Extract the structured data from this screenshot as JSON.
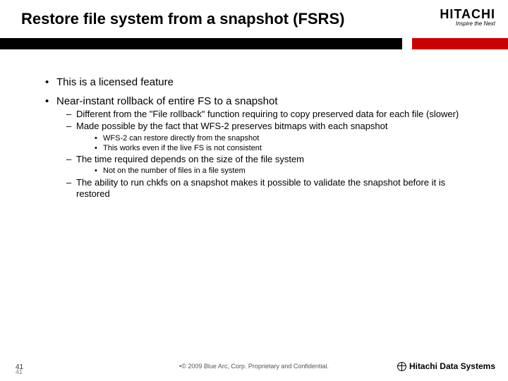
{
  "title": "Restore file system from a snapshot (FSRS)",
  "brand": {
    "name": "HITACHI",
    "tagline": "Inspire the Next",
    "footer_brand": "Hitachi Data Systems"
  },
  "bullets": {
    "b1": "This is a licensed feature",
    "b2": "Near-instant rollback of entire FS to a snapshot",
    "b2_sub": {
      "s1": "Different from the \"File rollback\" function requiring to copy preserved data for each file (slower)",
      "s2": "Made possible by the fact that WFS-2 preserves bitmaps with each snapshot",
      "s2_sub": {
        "t1": "WFS-2 can restore directly from the snapshot",
        "t2": "This works even if the live FS is not consistent"
      },
      "s3": "The time required depends on the size of the file system",
      "s3_sub": {
        "t1": "Not on the number of files in a file system"
      },
      "s4": "The ability to run chkfs on a snapshot makes it possible to validate the snapshot before it is restored"
    }
  },
  "footer": {
    "page": "41",
    "page_shadow": "41",
    "copyright": "•© 2009 Blue Arc, Corp. Proprietary and Confidential."
  }
}
